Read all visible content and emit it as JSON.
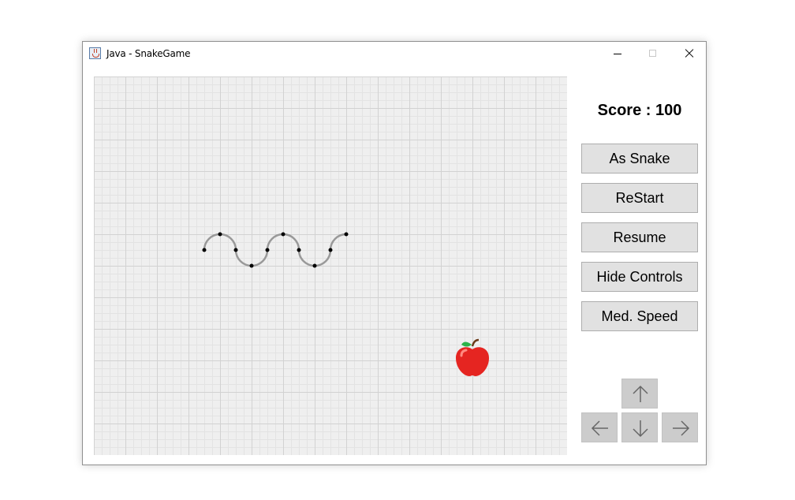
{
  "window": {
    "title": "Java - SnakeGame",
    "controls": [
      "minimize-icon",
      "maximize-icon",
      "close-icon"
    ]
  },
  "score": {
    "text": "Score : 100",
    "value": 100
  },
  "buttons": {
    "as_snake": "As Snake",
    "restart": "ReStart",
    "resume": "Resume",
    "hide_controls": "Hide Controls",
    "speed": "Med. Speed"
  },
  "arrows": [
    "arrow-up-icon",
    "arrow-left-icon",
    "arrow-down-icon",
    "arrow-right-icon"
  ],
  "game": {
    "grid_cols": 60,
    "grid_rows": 48,
    "snake_cells": [
      [
        14,
        22
      ],
      [
        16,
        20
      ],
      [
        18,
        22
      ],
      [
        20,
        24
      ],
      [
        22,
        22
      ],
      [
        24,
        20
      ],
      [
        26,
        22
      ],
      [
        28,
        24
      ],
      [
        30,
        22
      ],
      [
        32,
        20
      ]
    ],
    "food": {
      "type": "apple",
      "cell": [
        48,
        36
      ]
    }
  },
  "colors": {
    "board": "#efefef",
    "grid_major": "#d2d2d2",
    "grid_minor": "#e3e3e3",
    "snake_body": "#999999",
    "snake_joint": "#000000",
    "button_bg": "#e1e1e1",
    "arrow_bg": "#cccccc",
    "apple": "#e52521"
  }
}
